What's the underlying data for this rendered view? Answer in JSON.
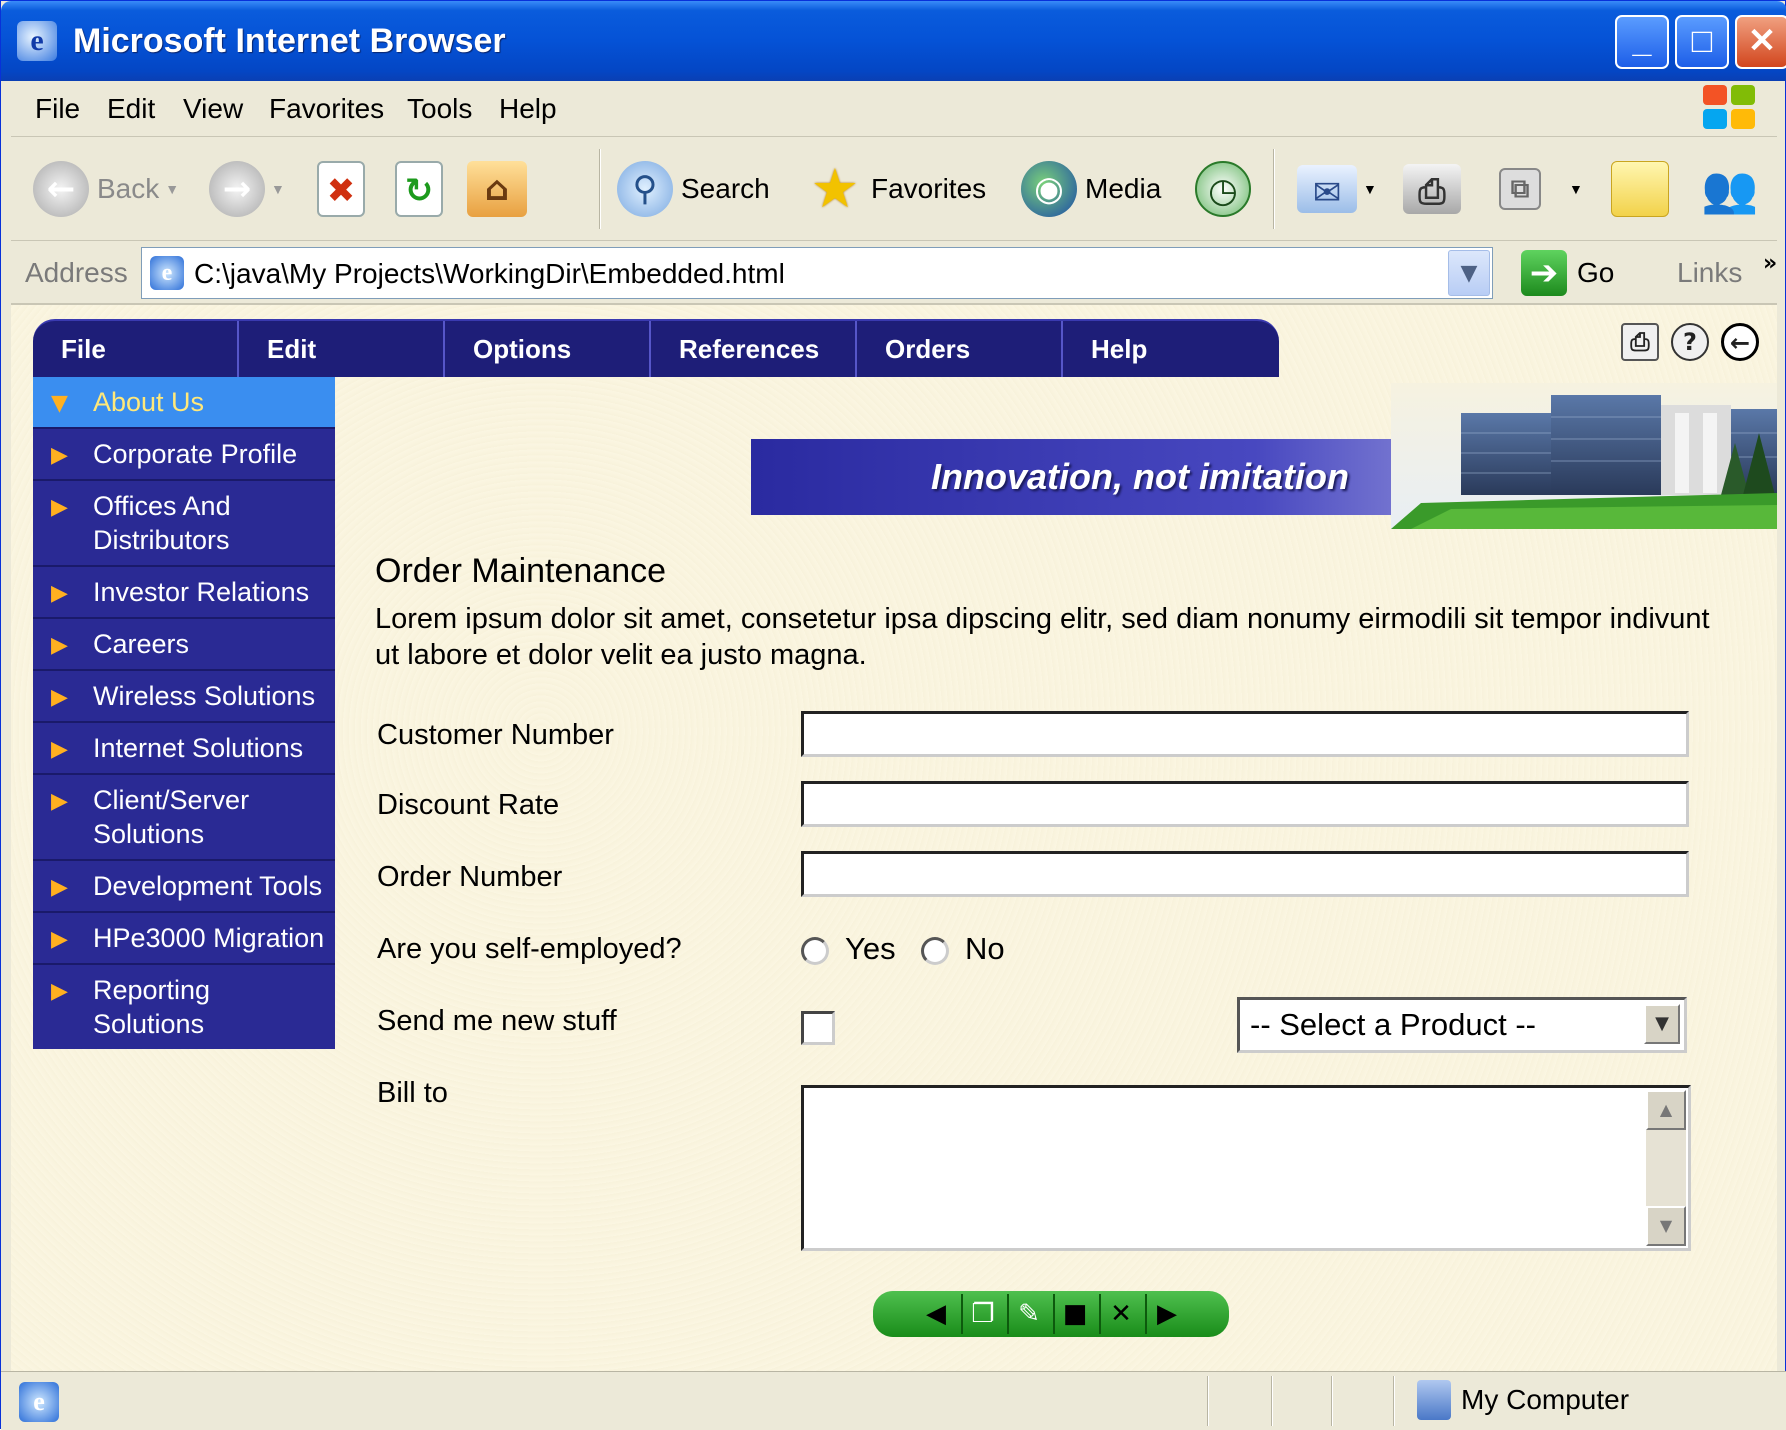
{
  "window": {
    "title": "Microsoft Internet Browser"
  },
  "menu": {
    "items": [
      "File",
      "Edit",
      "View",
      "Favorites",
      "Tools",
      "Help"
    ]
  },
  "toolbar": {
    "back": "Back",
    "search": "Search",
    "favorites": "Favorites",
    "media": "Media"
  },
  "address": {
    "label": "Address",
    "url": "C:\\java\\My Projects\\WorkingDir\\Embedded.html",
    "go": "Go",
    "links": "Links"
  },
  "app_nav": {
    "items": [
      "File",
      "Edit",
      "Options",
      "References",
      "Orders",
      "Help"
    ]
  },
  "sidebar": {
    "active_index": 0,
    "items": [
      {
        "label": "About Us"
      },
      {
        "label": "Corporate Profile"
      },
      {
        "label": "Offices And Distributors"
      },
      {
        "label": "Investor Relations"
      },
      {
        "label": "Careers"
      },
      {
        "label": "Wireless Solutions"
      },
      {
        "label": "Internet Solutions"
      },
      {
        "label": "Client/Server Solutions"
      },
      {
        "label": "Development Tools"
      },
      {
        "label": "HPe3000 Migration"
      },
      {
        "label": "Reporting Solutions"
      }
    ]
  },
  "banner": {
    "tagline": "Innovation, not imitation"
  },
  "form": {
    "title": "Order Maintenance",
    "description": "Lorem ipsum dolor sit amet, consetetur ipsa dipscing elitr, sed diam nonumy eirmodili sit tempor indivunt ut labore et dolor velit ea justo magna.",
    "customer_number": {
      "label": "Customer Number",
      "value": ""
    },
    "discount_rate": {
      "label": "Discount Rate",
      "value": ""
    },
    "order_number": {
      "label": "Order Number",
      "value": ""
    },
    "self_employed": {
      "label": "Are you self-employed?",
      "yes": "Yes",
      "no": "No"
    },
    "send_stuff": {
      "label": "Send me new stuff"
    },
    "product": {
      "selected": "-- Select a Product --"
    },
    "bill_to": {
      "label": "Bill to",
      "value": ""
    }
  },
  "status": {
    "zone": "My Computer"
  },
  "colors": {
    "nav_bg": "#1E1E78",
    "sidebar_bg": "#2A2A94",
    "sidebar_active": "#3A8EF0",
    "content_bg": "#FBF6E2",
    "record_nav": "#2EA82E"
  }
}
